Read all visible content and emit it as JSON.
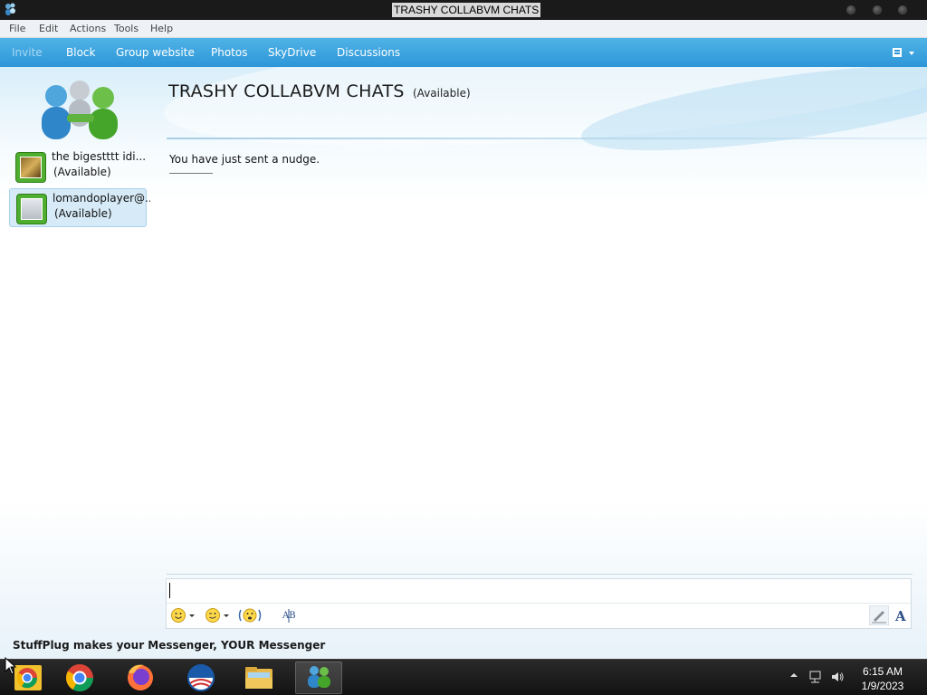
{
  "window": {
    "title": "TRASHY COLLABVM CHATS",
    "buttons": [
      "minimize-button",
      "maximize-button",
      "close-button"
    ]
  },
  "menu": {
    "items": [
      "File",
      "Edit",
      "Actions",
      "Tools",
      "Help"
    ]
  },
  "toolbar": {
    "items": [
      "Invite",
      "Block",
      "Group website",
      "Photos",
      "SkyDrive",
      "Discussions"
    ],
    "invite_disabled": true
  },
  "contacts": [
    {
      "name": "the bigestttt idi...",
      "status": "(Available)",
      "selected": false
    },
    {
      "name": "lomandoplayer@...",
      "status": "(Available)",
      "selected": true
    }
  ],
  "conversation": {
    "title": "TRASHY COLLABVM CHATS",
    "status": "(Available)",
    "messages": [
      "You have just sent a nudge."
    ]
  },
  "input": {
    "value": "",
    "format_icons": [
      "emoticon-icon",
      "wink-icon",
      "nudge-icon",
      "spellcheck-icon",
      "handwriting-icon",
      "font-icon"
    ]
  },
  "footer": {
    "ad_text": "StuffPlug makes your Messenger, YOUR Messenger"
  },
  "taskbar": {
    "apps": [
      "chrome-icon",
      "chrome-icon",
      "firefox-icon",
      "obama-logo-icon",
      "file-explorer-icon",
      "messenger-icon"
    ],
    "active_app": "messenger-icon",
    "time": "6:15 AM",
    "date": "1/9/2023"
  },
  "colors": {
    "toolbar": "#2d96d8",
    "title_bar": "#1a1a1a",
    "taskbar": "#121212",
    "avatar_frame": "#4fae2f"
  }
}
